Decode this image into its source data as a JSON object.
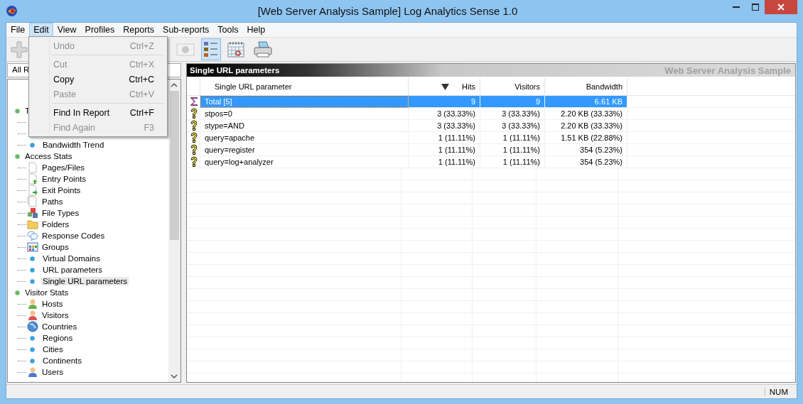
{
  "window": {
    "title": "[Web Server Analysis Sample] Log Analytics Sense 1.0"
  },
  "menu_bar": [
    {
      "label": "File",
      "selected": false
    },
    {
      "label": "Edit",
      "selected": true
    },
    {
      "label": "View",
      "selected": false
    },
    {
      "label": "Profiles",
      "selected": false
    },
    {
      "label": "Reports",
      "selected": false
    },
    {
      "label": "Sub-reports",
      "selected": false
    },
    {
      "label": "Tools",
      "selected": false
    },
    {
      "label": "Help",
      "selected": false
    }
  ],
  "edit_menu": [
    {
      "kind": "item",
      "label": "Undo",
      "shortcut": "Ctrl+Z",
      "disabled": true
    },
    {
      "kind": "separator"
    },
    {
      "kind": "item",
      "label": "Cut",
      "shortcut": "Ctrl+X",
      "disabled": true
    },
    {
      "kind": "item",
      "label": "Copy",
      "shortcut": "Ctrl+C",
      "disabled": false
    },
    {
      "kind": "item",
      "label": "Paste",
      "shortcut": "Ctrl+V",
      "disabled": true
    },
    {
      "kind": "separator"
    },
    {
      "kind": "item",
      "label": "Find In Report",
      "shortcut": "Ctrl+F",
      "disabled": false
    },
    {
      "kind": "item",
      "label": "Find Again",
      "shortcut": "F3",
      "disabled": true
    }
  ],
  "toolbar": [
    {
      "kind": "add",
      "disabled": true,
      "selected": false
    },
    {
      "kind": "record",
      "disabled": true,
      "selected": false
    },
    {
      "kind": "list",
      "disabled": false,
      "selected": true
    },
    {
      "kind": "calendar",
      "selected": false
    },
    {
      "kind": "print",
      "selected": false
    }
  ],
  "report_selector": {
    "value": "All R"
  },
  "tree": [
    {
      "kind": "leaf"
    },
    {
      "kind": "leaf"
    },
    {
      "kind": "group",
      "label": "T",
      "children": [
        {
          "kind": "leaf"
        },
        {
          "kind": "leaf"
        },
        {
          "kind": "leaf",
          "label": "Bandwidth Trend",
          "selected": false
        }
      ]
    },
    {
      "kind": "group",
      "label": "Access Stats",
      "children": [
        {
          "kind": "leaf",
          "label": "Pages/Files",
          "selected": false
        },
        {
          "kind": "leaf",
          "label": "Entry Points",
          "selected": false
        },
        {
          "kind": "leaf",
          "label": "Exit Points",
          "selected": false
        },
        {
          "kind": "leaf",
          "label": "Paths",
          "selected": false
        },
        {
          "kind": "leaf",
          "label": "File Types",
          "selected": false
        },
        {
          "kind": "leaf",
          "label": "Folders",
          "selected": false
        },
        {
          "kind": "leaf",
          "label": "Response Codes",
          "selected": false
        },
        {
          "kind": "leaf",
          "label": "Groups",
          "selected": false
        },
        {
          "kind": "leaf",
          "label": "Virtual Domains",
          "selected": false
        },
        {
          "kind": "leaf",
          "label": "URL parameters",
          "selected": false
        },
        {
          "kind": "leaf",
          "label": "Single URL parameters",
          "selected": true
        }
      ]
    },
    {
      "kind": "group",
      "label": "Visitor Stats",
      "children": [
        {
          "kind": "leaf",
          "label": "Hosts",
          "selected": false
        },
        {
          "kind": "leaf",
          "label": "Visitors",
          "selected": false
        },
        {
          "kind": "leaf",
          "label": "Countries",
          "selected": false
        },
        {
          "kind": "leaf",
          "label": "Regions",
          "selected": false
        },
        {
          "kind": "leaf",
          "label": "Cities",
          "selected": false
        },
        {
          "kind": "leaf",
          "label": "Continents",
          "selected": false
        },
        {
          "kind": "leaf",
          "label": "Users",
          "selected": false
        }
      ]
    }
  ],
  "report": {
    "title": "Single URL parameters",
    "profile": "Web Server Analysis Sample",
    "columns": [
      {
        "label": "Single URL parameter",
        "sorted": false
      },
      {
        "label": "Hits",
        "sorted": true
      },
      {
        "label": "Visitors",
        "sorted": false
      },
      {
        "label": "Bandwidth",
        "sorted": false
      }
    ],
    "rows": [
      {
        "kind": "total",
        "selected": true,
        "cells": [
          "Total [5]",
          "9",
          "9",
          "6.61 KB"
        ]
      },
      {
        "kind": "item",
        "selected": false,
        "cells": [
          "stpos=0",
          "3 (33.33%)",
          "3 (33.33%)",
          "2.20 KB (33.33%)"
        ]
      },
      {
        "kind": "item",
        "selected": false,
        "cells": [
          "stype=AND",
          "3 (33.33%)",
          "3 (33.33%)",
          "2.20 KB (33.33%)"
        ]
      },
      {
        "kind": "item",
        "selected": false,
        "cells": [
          "query=apache",
          "1 (11.11%)",
          "1 (11.11%)",
          "1.51 KB (22.88%)"
        ]
      },
      {
        "kind": "item",
        "selected": false,
        "cells": [
          "query=register",
          "1 (11.11%)",
          "1 (11.11%)",
          "354 (5.23%)"
        ]
      },
      {
        "kind": "item",
        "selected": false,
        "cells": [
          "query=log+analyzer",
          "1 (11.11%)",
          "1 (11.11%)",
          "354 (5.23%)"
        ]
      }
    ]
  },
  "status_bar": {
    "num_lock": "NUM"
  }
}
